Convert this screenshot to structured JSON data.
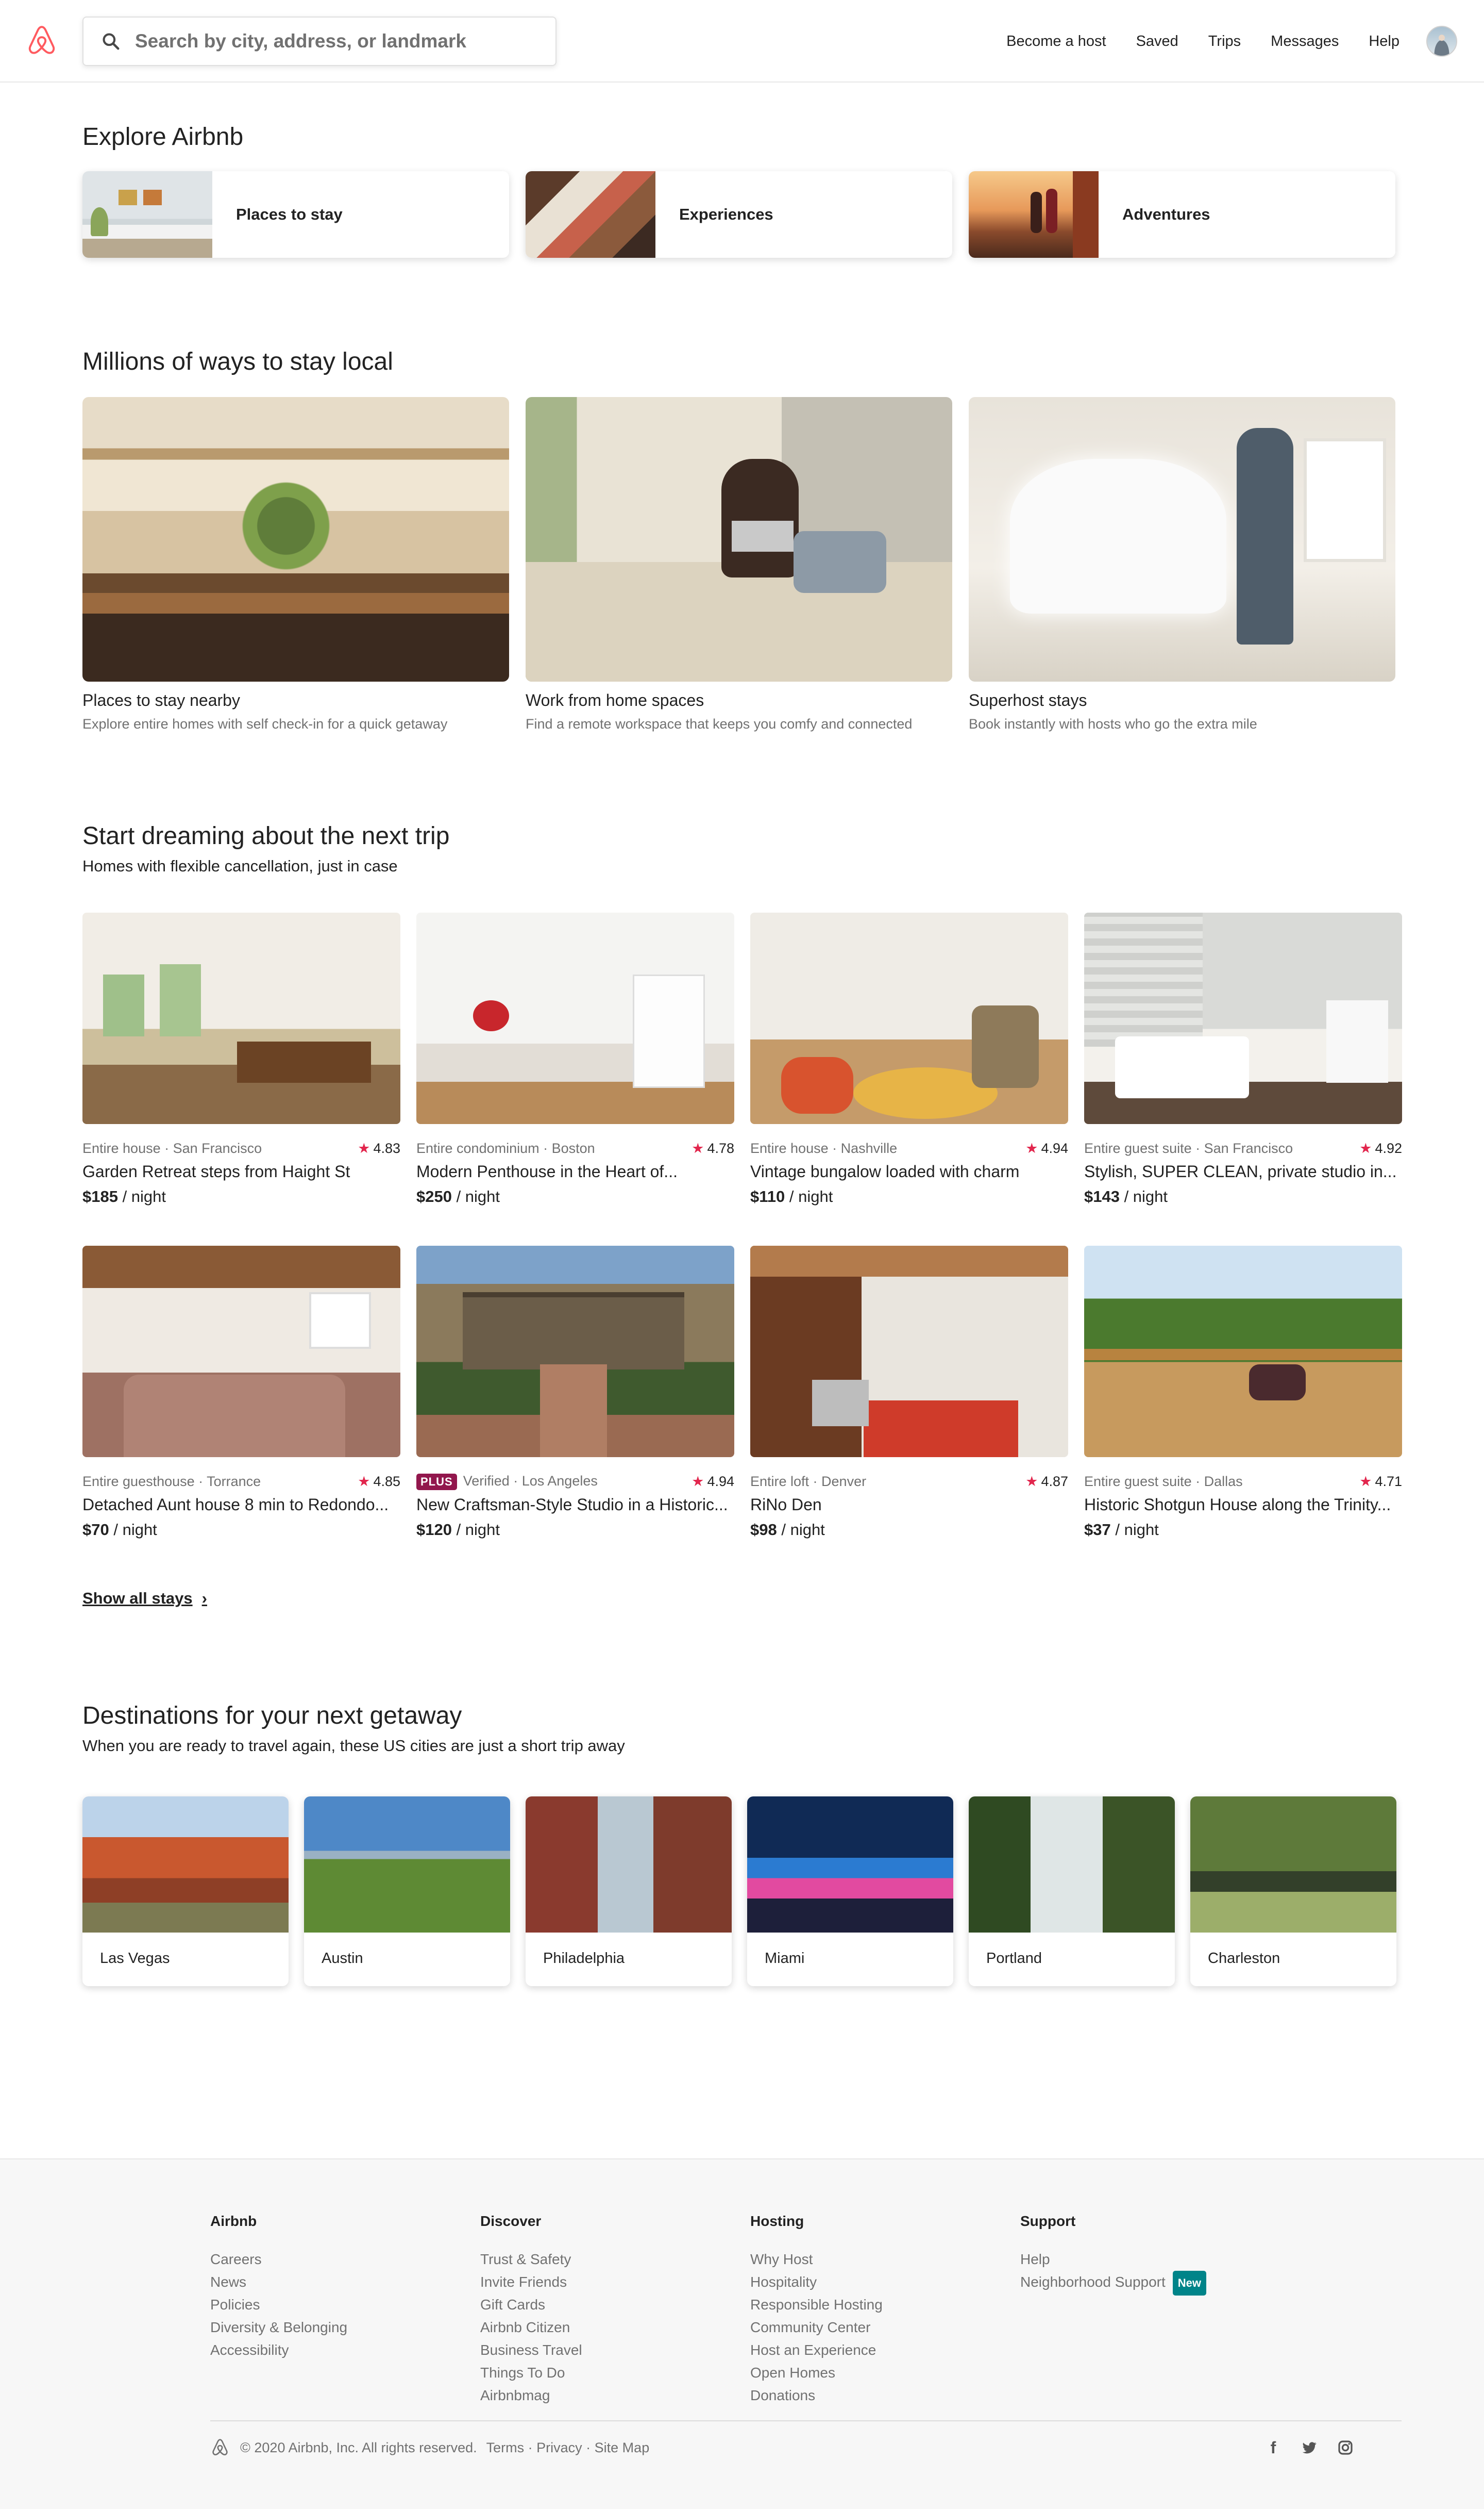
{
  "header": {
    "search_placeholder": "Search by city, address, or landmark",
    "nav": [
      "Become a host",
      "Saved",
      "Trips",
      "Messages",
      "Help"
    ]
  },
  "explore": {
    "title": "Explore Airbnb",
    "cards": [
      "Places to stay",
      "Experiences",
      "Adventures"
    ]
  },
  "stay_local": {
    "title": "Millions of ways to stay local",
    "cards": [
      {
        "title": "Places to stay nearby",
        "subtitle": "Explore entire homes with self check-in for a quick getaway"
      },
      {
        "title": "Work from home spaces",
        "subtitle": "Find a remote workspace that keeps you comfy and connected"
      },
      {
        "title": "Superhost stays",
        "subtitle": "Book instantly with hosts who go the extra mile"
      }
    ]
  },
  "dreaming": {
    "title": "Start dreaming about the next trip",
    "subtitle": "Homes with flexible cancellation, just in case",
    "listings": [
      {
        "meta": "Entire house · San Francisco",
        "rating": "4.83",
        "title": "Garden Retreat steps from Haight St",
        "price": "$185",
        "unit": " / night"
      },
      {
        "meta": "Entire condominium · Boston",
        "rating": "4.78",
        "title": "Modern Penthouse in the Heart of...",
        "price": "$250",
        "unit": " / night"
      },
      {
        "meta": "Entire house · Nashville",
        "rating": "4.94",
        "title": "Vintage bungalow loaded with charm",
        "price": "$110",
        "unit": " / night"
      },
      {
        "meta": "Entire guest suite · San Francisco",
        "rating": "4.92",
        "title": "Stylish, SUPER CLEAN, private studio in...",
        "price": "$143",
        "unit": " / night"
      },
      {
        "meta": "Entire guesthouse · Torrance",
        "rating": "4.85",
        "title": "Detached Aunt house 8 min to Redondo...",
        "price": "$70",
        "unit": " / night"
      },
      {
        "meta": "Verified · Los Angeles",
        "plus": "PLUS",
        "rating": "4.94",
        "title": "New Craftsman-Style Studio in a Historic...",
        "price": "$120",
        "unit": " / night"
      },
      {
        "meta": "Entire loft · Denver",
        "rating": "4.87",
        "title": "RiNo Den",
        "price": "$98",
        "unit": " / night"
      },
      {
        "meta": "Entire guest suite · Dallas",
        "rating": "4.71",
        "title": "Historic Shotgun House along the Trinity...",
        "price": "$37",
        "unit": " / night"
      }
    ],
    "show_all": "Show all stays"
  },
  "destinations": {
    "title": "Destinations for your next getaway",
    "subtitle": "When you are ready to travel again, these US cities are just a short trip away",
    "cities": [
      "Las Vegas",
      "Austin",
      "Philadelphia",
      "Miami",
      "Portland",
      "Charleston"
    ]
  },
  "footer": {
    "columns": [
      {
        "heading": "Airbnb",
        "links": [
          "Careers",
          "News",
          "Policies",
          "Diversity & Belonging",
          "Accessibility"
        ]
      },
      {
        "heading": "Discover",
        "links": [
          "Trust & Safety",
          "Invite Friends",
          "Gift Cards",
          "Airbnb Citizen",
          "Business Travel",
          "Things To Do",
          "Airbnbmag"
        ]
      },
      {
        "heading": "Hosting",
        "links": [
          "Why Host",
          "Hospitality",
          "Responsible Hosting",
          "Community Center",
          "Host an Experience",
          "Open Homes",
          "Donations"
        ]
      },
      {
        "heading": "Support",
        "links": [
          "Help",
          "Neighborhood Support"
        ],
        "badge": "New"
      }
    ],
    "copyright": "© 2020 Airbnb, Inc. All rights reserved.",
    "legal_links": [
      "Terms",
      "Privacy",
      "Site Map"
    ],
    "legal_sep": " · ",
    "social_icons": [
      "facebook-icon",
      "twitter-icon",
      "instagram-icon"
    ]
  },
  "colors": {
    "brand": "#FF5A5F",
    "star": "#E2264D",
    "plus": "#92174D",
    "new_badge": "#008489"
  }
}
